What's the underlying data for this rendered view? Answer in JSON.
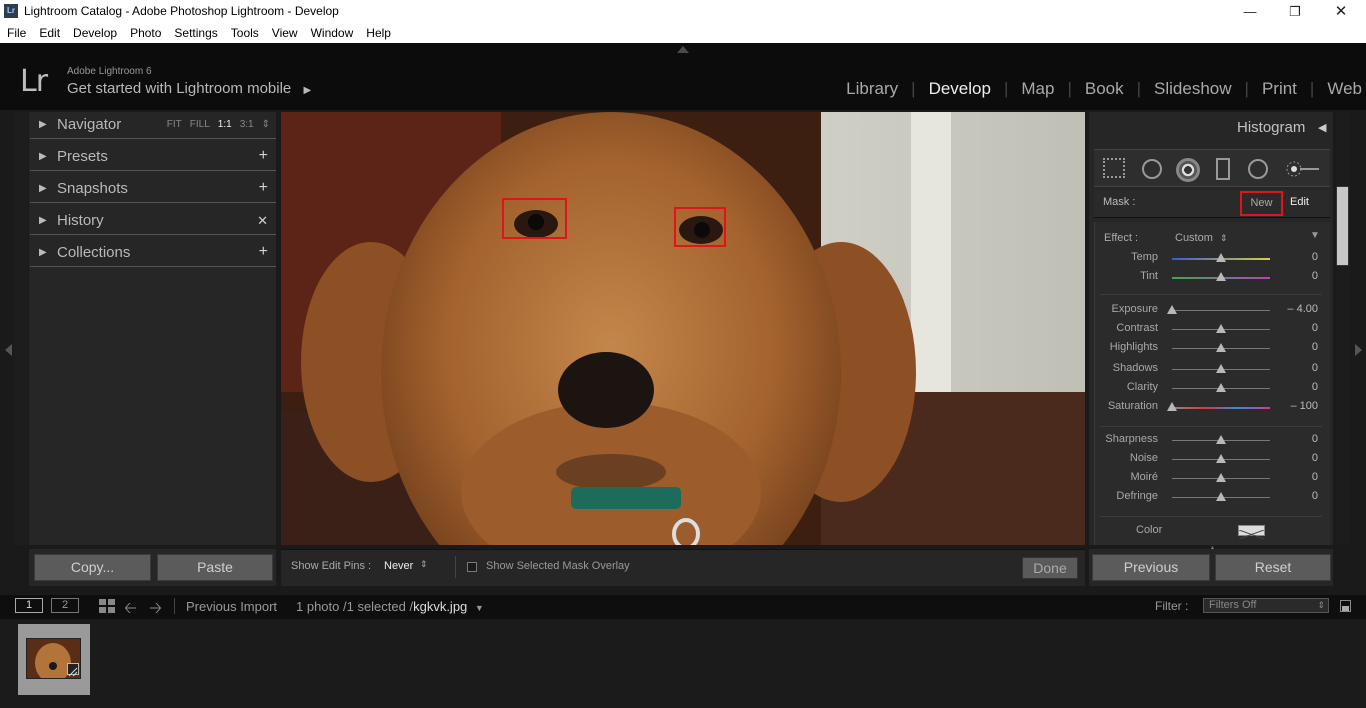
{
  "window": {
    "app_icon": "Lr",
    "title": "Lightroom Catalog - Adobe Photoshop Lightroom - Develop",
    "controls": [
      "minimize-icon",
      "restore-icon",
      "close-icon"
    ]
  },
  "menu": [
    "File",
    "Edit",
    "Develop",
    "Photo",
    "Settings",
    "Tools",
    "View",
    "Window",
    "Help"
  ],
  "identity": {
    "logo": "Lr",
    "version": "Adobe Lightroom 6",
    "mobile": "Get started with Lightroom mobile",
    "mobile_arrow": "▶"
  },
  "modules": {
    "library": "Library",
    "develop": "Develop",
    "map": "Map",
    "book": "Book",
    "slideshow": "Slideshow",
    "print": "Print",
    "web": "Web",
    "active": "Develop"
  },
  "left_panel": {
    "navigator": {
      "label": "Navigator",
      "opts": [
        "FIT",
        "FILL",
        "1:1",
        "3:1"
      ],
      "selected": "1:1",
      "spinner": "⇕"
    },
    "presets": {
      "label": "Presets",
      "action": "+"
    },
    "snapshots": {
      "label": "Snapshots",
      "action": "+"
    },
    "history": {
      "label": "History",
      "action": "✕"
    },
    "collections": {
      "label": "Collections",
      "action": "+"
    }
  },
  "right_panel": {
    "histogram": "Histogram",
    "tools": [
      "crop-overlay-icon",
      "spot-removal-icon",
      "red-eye-icon",
      "graduated-filter-icon",
      "radial-filter-icon",
      "adjustment-brush-icon"
    ],
    "mask_label": "Mask :",
    "new_label": "New",
    "edit_label": "Edit",
    "effect_label": "Effect :",
    "effect_value": "Custom",
    "sliders": [
      {
        "name": "Temp",
        "value": "0",
        "pos": 0.5
      },
      {
        "name": "Tint",
        "value": "0",
        "pos": 0.5
      },
      {
        "name": "Exposure",
        "value": "– 4.00",
        "pos": 0.0
      },
      {
        "name": "Contrast",
        "value": "0",
        "pos": 0.5
      },
      {
        "name": "Highlights",
        "value": "0",
        "pos": 0.5
      },
      {
        "name": "Shadows",
        "value": "0",
        "pos": 0.5
      },
      {
        "name": "Clarity",
        "value": "0",
        "pos": 0.5
      },
      {
        "name": "Saturation",
        "value": "– 100",
        "pos": 0.0
      },
      {
        "name": "Sharpness",
        "value": "0",
        "pos": 0.5
      },
      {
        "name": "Noise",
        "value": "0",
        "pos": 0.5
      },
      {
        "name": "Moiré",
        "value": "0",
        "pos": 0.5
      },
      {
        "name": "Defringe",
        "value": "0",
        "pos": 0.5
      }
    ],
    "color_label": "Color"
  },
  "bottom": {
    "copy": "Copy...",
    "paste": "Paste",
    "show_edit_pins_label": "Show Edit Pins :",
    "show_edit_pins_value": "Never",
    "mask_overlay_label": "Show Selected Mask Overlay",
    "done": "Done",
    "previous": "Previous",
    "reset": "Reset"
  },
  "filmbar": {
    "screen1": "1",
    "screen2": "2",
    "source": "Previous Import",
    "count": "1 photo /1 selected /",
    "filename": "kgkvk.jpg",
    "filter_label": "Filter :",
    "filter_value": "Filters Off"
  },
  "colors": {
    "highlight_box": "#e0141a",
    "panel_bg": "#262626",
    "button_bg": "#5b5b5b"
  }
}
